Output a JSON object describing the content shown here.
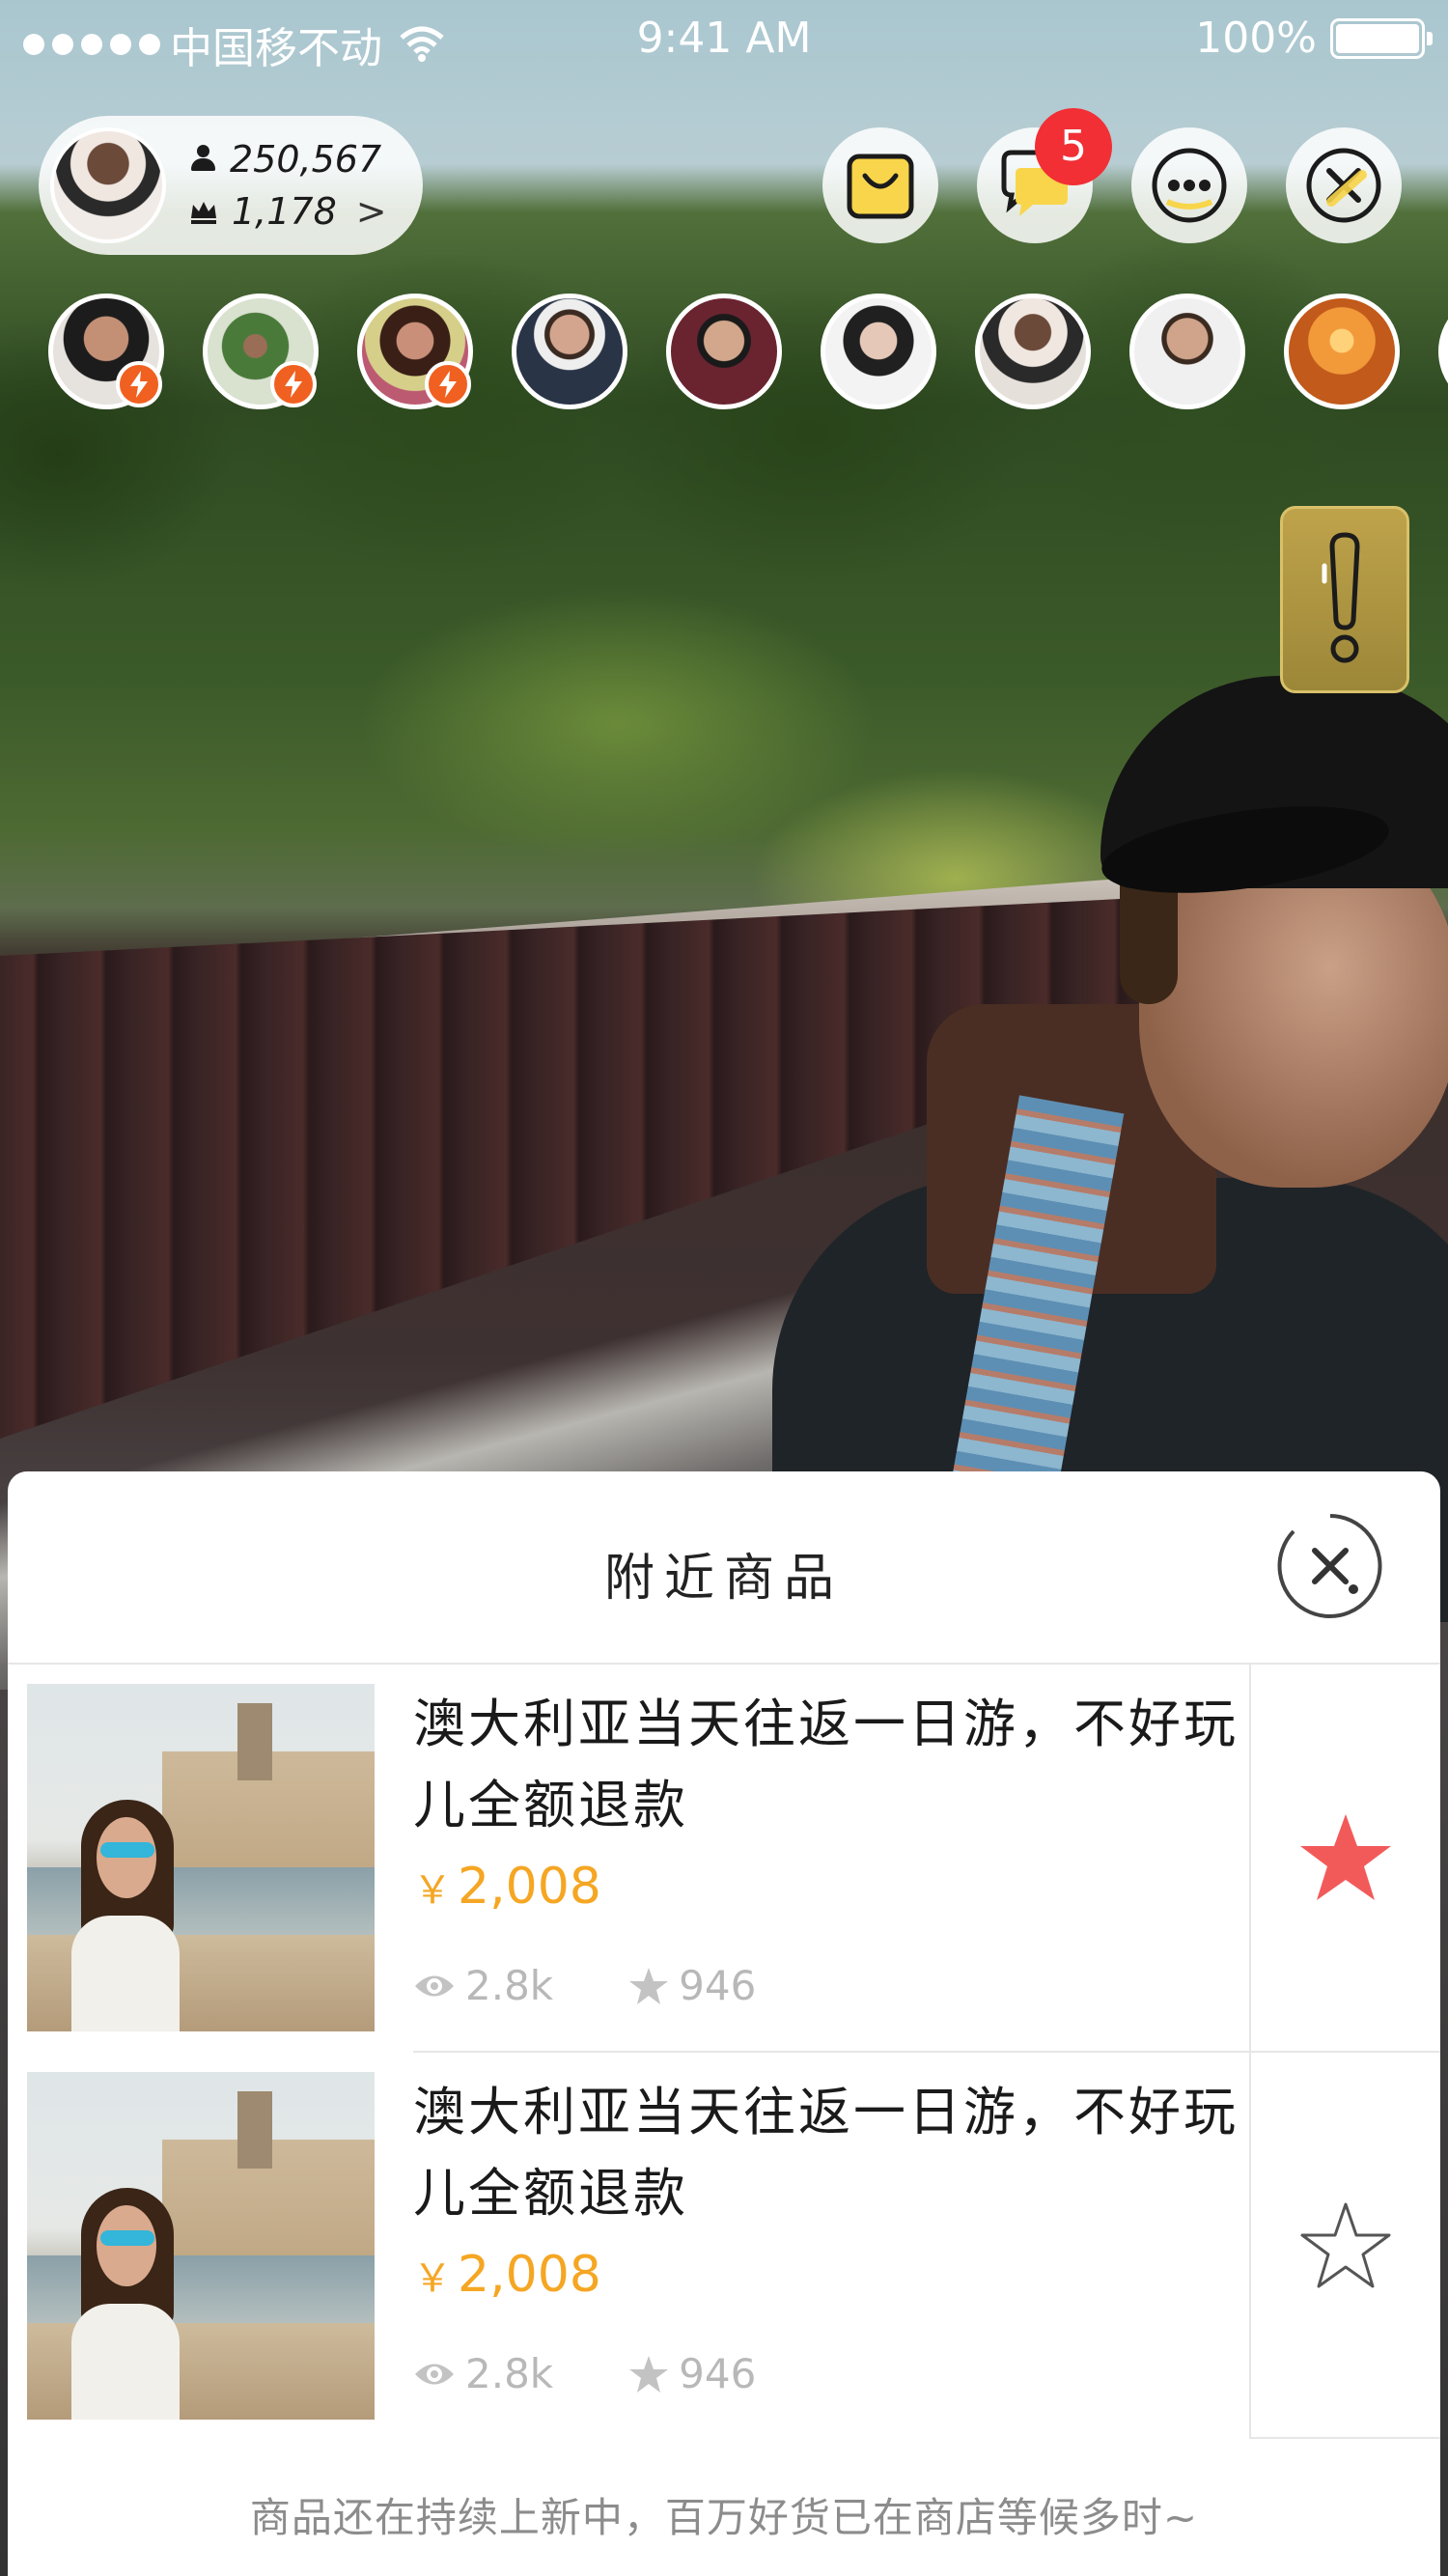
{
  "status_bar": {
    "carrier": "中国移不动",
    "time": "9:41 AM",
    "battery": "100%"
  },
  "host": {
    "followers": "250,567",
    "rank": "1,178",
    "chevron": ">"
  },
  "top_actions": {
    "icons": [
      "shopping-bag-icon",
      "chat-icon",
      "more-icon",
      "close-icon"
    ],
    "chat_badge": "5"
  },
  "viewers": [
    {
      "icon": "viewer-avatar",
      "vip": true
    },
    {
      "icon": "viewer-avatar",
      "vip": true
    },
    {
      "icon": "viewer-avatar",
      "vip": true
    },
    {
      "icon": "viewer-avatar",
      "vip": false
    },
    {
      "icon": "viewer-avatar",
      "vip": false
    },
    {
      "icon": "viewer-avatar",
      "vip": false
    },
    {
      "icon": "viewer-avatar",
      "vip": false
    },
    {
      "icon": "viewer-avatar",
      "vip": false
    },
    {
      "icon": "viewer-avatar",
      "vip": false
    }
  ],
  "sheet": {
    "title": "附近商品",
    "footer": "商品还在持续上新中，百万好货已在商店等候多时~",
    "items": [
      {
        "title": "澳大利亚当天往返一日游，不好玩儿全额退款",
        "currency": "￥",
        "price": "2,008",
        "views": "2.8k",
        "stars": "946",
        "favorited": true
      },
      {
        "title": "澳大利亚当天往返一日游，不好玩儿全额退款",
        "currency": "￥",
        "price": "2,008",
        "views": "2.8k",
        "stars": "946",
        "favorited": false
      }
    ]
  },
  "colors": {
    "accent_yellow": "#f8d54a",
    "price_orange": "#f5a623",
    "favorite_red": "#f25a5a",
    "badge_red": "#f12f35",
    "vip_orange": "#f06020"
  }
}
